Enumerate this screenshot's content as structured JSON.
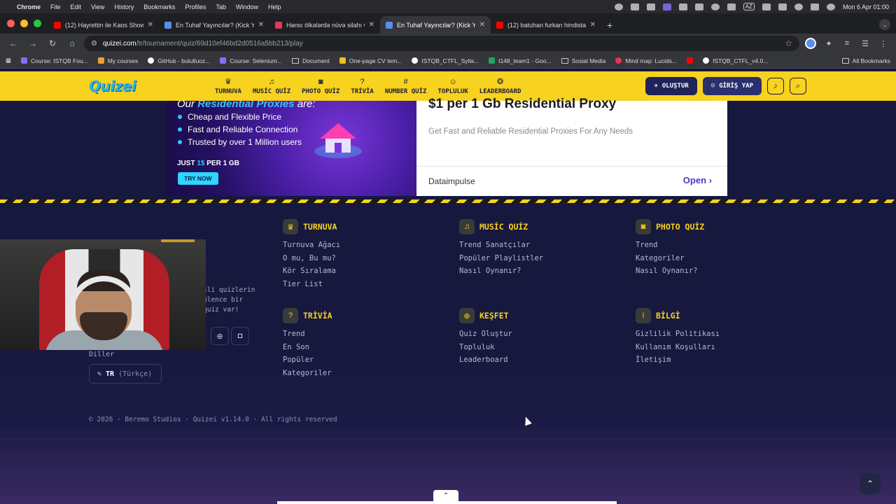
{
  "mac_menu": {
    "app": "Chrome",
    "items": [
      "File",
      "Edit",
      "View",
      "History",
      "Bookmarks",
      "Profiles",
      "Tab",
      "Window",
      "Help"
    ],
    "input_lang": "AZ",
    "datetime": "Mon 6 Apr  01:00"
  },
  "tabs": [
    {
      "title": "(12) Hayrettin ile Kaos Show",
      "favicon_color": "#ff0000",
      "active": false
    },
    {
      "title": "En Tuhaf Yayıncılar? (Kick Ya",
      "favicon_color": "#5b8def",
      "active": false
    },
    {
      "title": "Hansı ölkələrdə nüvə silahı va",
      "favicon_color": "#e03a5a",
      "active": false
    },
    {
      "title": "En Tuhaf Yayıncılar? (Kick Yay",
      "favicon_color": "#5b8def",
      "active": true
    },
    {
      "title": "(12) batuhan furkan hindistan",
      "favicon_color": "#ff0000",
      "active": false
    }
  ],
  "address": {
    "host": "quizei.com",
    "path": "/tr/tournament/quiz/69d10ef46bd2d0516a5bb213/play"
  },
  "bookmarks": [
    {
      "label": "Course: ISTQB Fou...",
      "color": "#8b6cf7"
    },
    {
      "label": "My courses",
      "color": "#f0a030"
    },
    {
      "label": "GitHub - bulutluoz...",
      "color": "#ffffff"
    },
    {
      "label": "Course: Selenium...",
      "color": "#8b6cf7"
    },
    {
      "label": "Document",
      "color": "folder"
    },
    {
      "label": "One-page CV tem...",
      "color": "#f0c020"
    },
    {
      "label": "ISTQB_CTFL_Sylla...",
      "color": "#ffffff"
    },
    {
      "label": "t148_team1 - Goo...",
      "color": "#1fa463"
    },
    {
      "label": "Sosial Media",
      "color": "folder"
    },
    {
      "label": "Mind map: Lucids...",
      "color": "#e8364a"
    },
    {
      "label": "ISTQB_CTFL_v4.0...",
      "color": "#ffffff"
    }
  ],
  "bookmarks_all": "All Bookmarks",
  "site": {
    "logo": "Quizei",
    "nav": [
      {
        "label": "TURNUVA",
        "icon": "trophy-icon",
        "glyph": "♛"
      },
      {
        "label": "MUSİC QUİZ",
        "icon": "music-icon",
        "glyph": "♫"
      },
      {
        "label": "PHOTO QUİZ",
        "icon": "camera-icon",
        "glyph": "◙"
      },
      {
        "label": "TRİVİA",
        "icon": "question-icon",
        "glyph": "?"
      },
      {
        "label": "NUMBER QUİZ",
        "icon": "hash-icon",
        "glyph": "#"
      },
      {
        "label": "TOPLULUK",
        "icon": "users-icon",
        "glyph": "☺"
      },
      {
        "label": "LEADERBOARD",
        "icon": "medal-icon",
        "glyph": "❂"
      }
    ],
    "create_label": "OLUŞTUR",
    "login_label": "GİRİŞ YAP"
  },
  "ad": {
    "heading_prefix": "Our",
    "heading_highlight": "Residential Proxies",
    "heading_suffix": "are:",
    "bullets": [
      "Cheap and Flexible Price",
      "Fast and Reliable Connection",
      "Trusted by over 1 Million users"
    ],
    "just_prefix": "JUST",
    "just_price": "1$",
    "just_suffix": "PER 1 GB",
    "try_label": "TRY NOW",
    "title": "$1 per 1 Gb Residential Proxy",
    "subtitle": "Get Fast and Reliable Residential Proxies For Any Needs",
    "brand": "Dataimpulse",
    "open_label": "Open"
  },
  "footer": {
    "columns": [
      {
        "title": "TURNUVA",
        "icon": "trophy-icon",
        "glyph": "♛",
        "links": [
          "Turnuva Ağacı",
          "O mu, Bu mu?",
          "Kör Sıralama",
          "Tier List"
        ]
      },
      {
        "title": "MUSİC QUİZ",
        "icon": "music-icon",
        "glyph": "♫",
        "links": [
          "Trend Sanatçılar",
          "Popüler Playlistler",
          "Nasıl Oynanır?"
        ]
      },
      {
        "title": "PHOTO QUİZ",
        "icon": "camera-icon",
        "glyph": "◙",
        "links": [
          "Trend",
          "Kategoriler",
          "Nasıl Oynanır?"
        ]
      },
      {
        "title": "TRİVİA",
        "icon": "question-icon",
        "glyph": "?",
        "links": [
          "Trend",
          "En Son",
          "Popüler",
          "Kategoriler"
        ]
      },
      {
        "title": "KEŞFET",
        "icon": "globe-icon",
        "glyph": "⊕",
        "links": [
          "Quiz Oluştur",
          "Topluluk",
          "Leaderboard"
        ]
      },
      {
        "title": "BİLGİ",
        "icon": "info-icon",
        "glyph": "i",
        "links": [
          "Gizlilik Politikası",
          "Kullanım Koşulları",
          "İletişim"
        ]
      }
    ],
    "brand_desc_lines": [
      "sli quizlerin",
      "ğlence bir",
      "quiz var!"
    ],
    "languages_label": "Diller",
    "lang_code": "TR",
    "lang_name": "(Türkçe)",
    "copyright": "© 2026 · Beremo Studios · Quizei v1.14.0 · All rights reserved"
  }
}
